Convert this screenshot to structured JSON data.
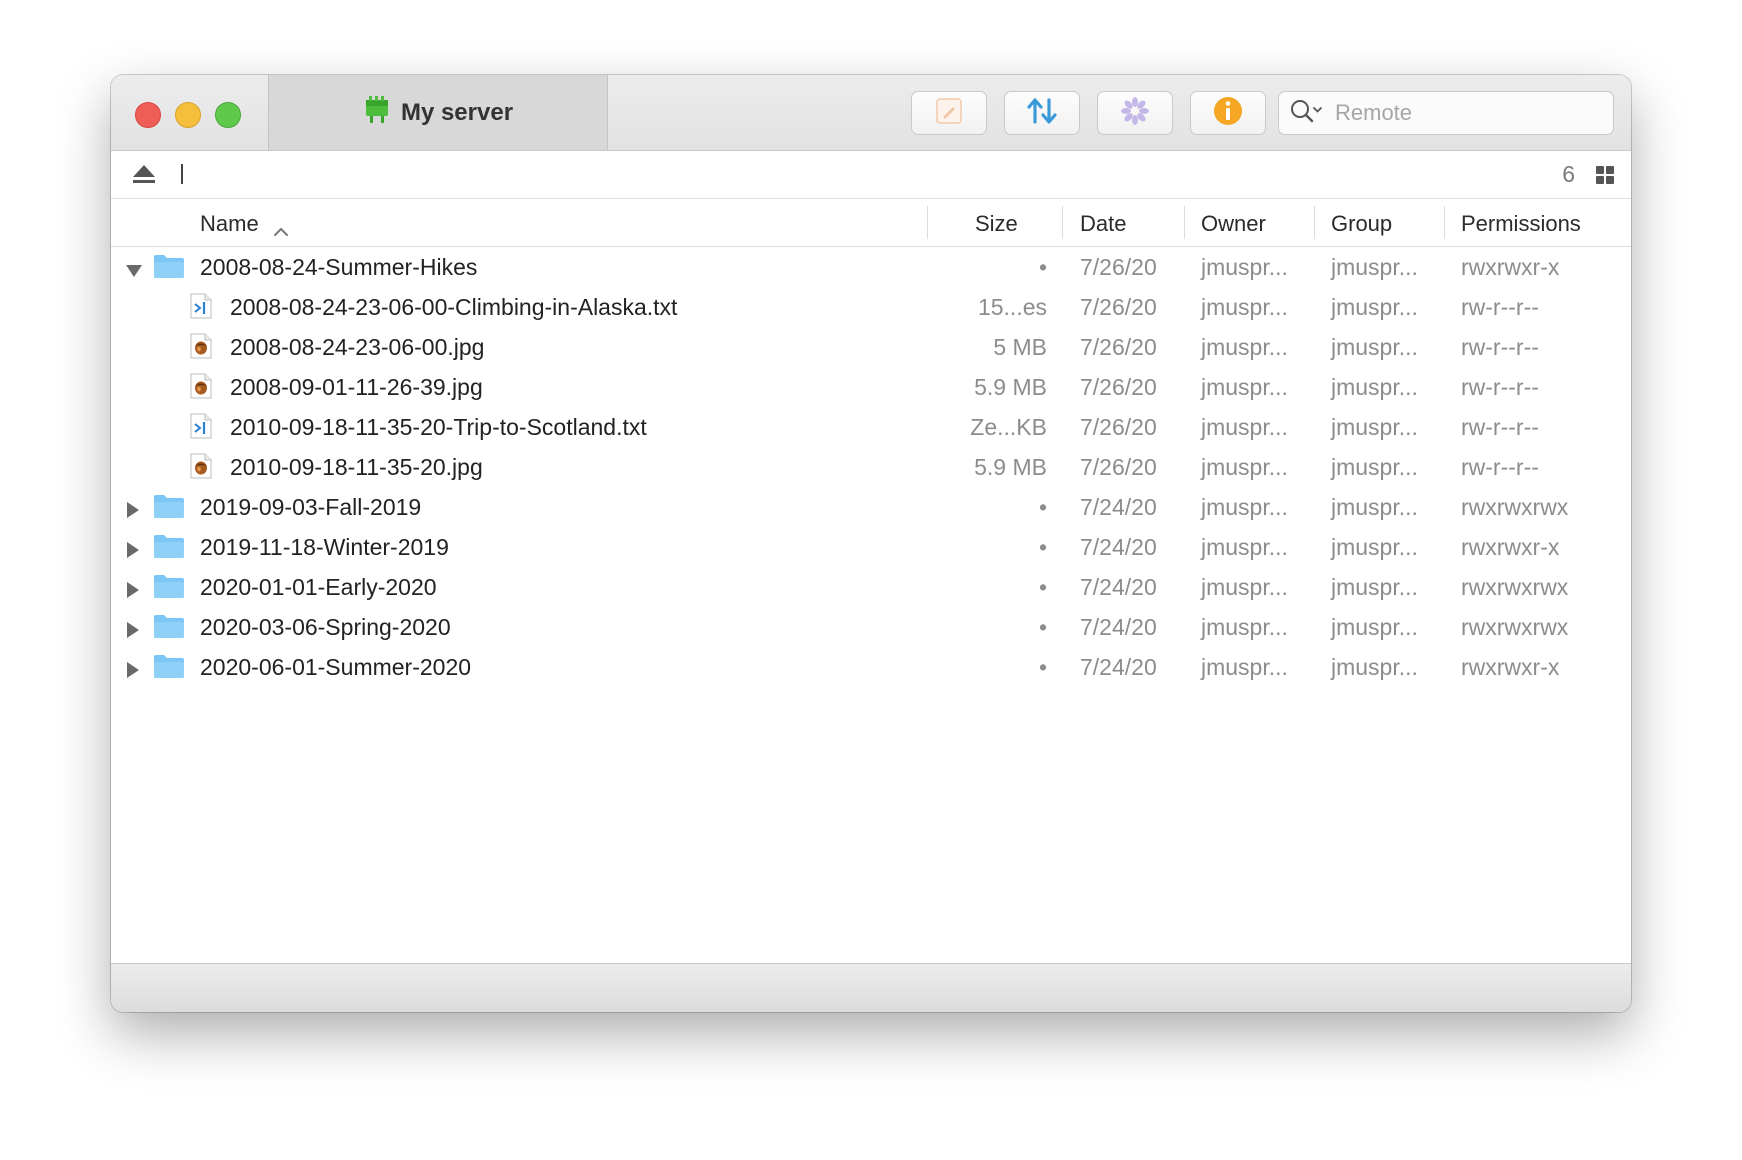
{
  "window": {
    "tab_title": "My server",
    "search_placeholder": "Remote"
  },
  "toolbar": {
    "buttons": [
      {
        "name": "edit-button",
        "icon": "pencil-icon"
      },
      {
        "name": "transfers-button",
        "icon": "up-down-arrows-icon"
      },
      {
        "name": "activity-button",
        "icon": "spinner-icon"
      },
      {
        "name": "info-button",
        "icon": "info-icon"
      }
    ]
  },
  "pathbar": {
    "count": "6"
  },
  "columns": {
    "name": "Name",
    "size": "Size",
    "date": "Date",
    "owner": "Owner",
    "group": "Group",
    "permissions": "Permissions"
  },
  "rows": [
    {
      "type": "folder",
      "expanded": true,
      "depth": 0,
      "name": "2008-08-24-Summer-Hikes",
      "size": "•",
      "date": "7/26/20",
      "owner": "jmuspr...",
      "group": "jmuspr...",
      "permissions": "rwxrwxr-x"
    },
    {
      "type": "txt",
      "depth": 1,
      "name": "2008-08-24-23-06-00-Climbing-in-Alaska.txt",
      "size": "15...es",
      "date": "7/26/20",
      "owner": "jmuspr...",
      "group": "jmuspr...",
      "permissions": "rw-r--r--"
    },
    {
      "type": "jpg",
      "depth": 1,
      "name": "2008-08-24-23-06-00.jpg",
      "size": "5 MB",
      "date": "7/26/20",
      "owner": "jmuspr...",
      "group": "jmuspr...",
      "permissions": "rw-r--r--"
    },
    {
      "type": "jpg",
      "depth": 1,
      "name": "2008-09-01-11-26-39.jpg",
      "size": "5.9 MB",
      "date": "7/26/20",
      "owner": "jmuspr...",
      "group": "jmuspr...",
      "permissions": "rw-r--r--"
    },
    {
      "type": "txt",
      "depth": 1,
      "name": "2010-09-18-11-35-20-Trip-to-Scotland.txt",
      "size": "Ze...KB",
      "date": "7/26/20",
      "owner": "jmuspr...",
      "group": "jmuspr...",
      "permissions": "rw-r--r--"
    },
    {
      "type": "jpg",
      "depth": 1,
      "name": "2010-09-18-11-35-20.jpg",
      "size": "5.9 MB",
      "date": "7/26/20",
      "owner": "jmuspr...",
      "group": "jmuspr...",
      "permissions": "rw-r--r--"
    },
    {
      "type": "folder",
      "expanded": false,
      "depth": 0,
      "name": "2019-09-03-Fall-2019",
      "size": "•",
      "date": "7/24/20",
      "owner": "jmuspr...",
      "group": "jmuspr...",
      "permissions": "rwxrwxrwx"
    },
    {
      "type": "folder",
      "expanded": false,
      "depth": 0,
      "name": "2019-11-18-Winter-2019",
      "size": "•",
      "date": "7/24/20",
      "owner": "jmuspr...",
      "group": "jmuspr...",
      "permissions": "rwxrwxr-x"
    },
    {
      "type": "folder",
      "expanded": false,
      "depth": 0,
      "name": "2020-01-01-Early-2020",
      "size": "•",
      "date": "7/24/20",
      "owner": "jmuspr...",
      "group": "jmuspr...",
      "permissions": "rwxrwxrwx"
    },
    {
      "type": "folder",
      "expanded": false,
      "depth": 0,
      "name": "2020-03-06-Spring-2020",
      "size": "•",
      "date": "7/24/20",
      "owner": "jmuspr...",
      "group": "jmuspr...",
      "permissions": "rwxrwxrwx"
    },
    {
      "type": "folder",
      "expanded": false,
      "depth": 0,
      "name": "2020-06-01-Summer-2020",
      "size": "•",
      "date": "7/24/20",
      "owner": "jmuspr...",
      "group": "jmuspr...",
      "permissions": "rwxrwxr-x"
    }
  ],
  "colors": {
    "folder": "#7cc6f5",
    "info": "#f5a623",
    "transfer": "#3a9ad9",
    "server": "#4cbd3c"
  }
}
